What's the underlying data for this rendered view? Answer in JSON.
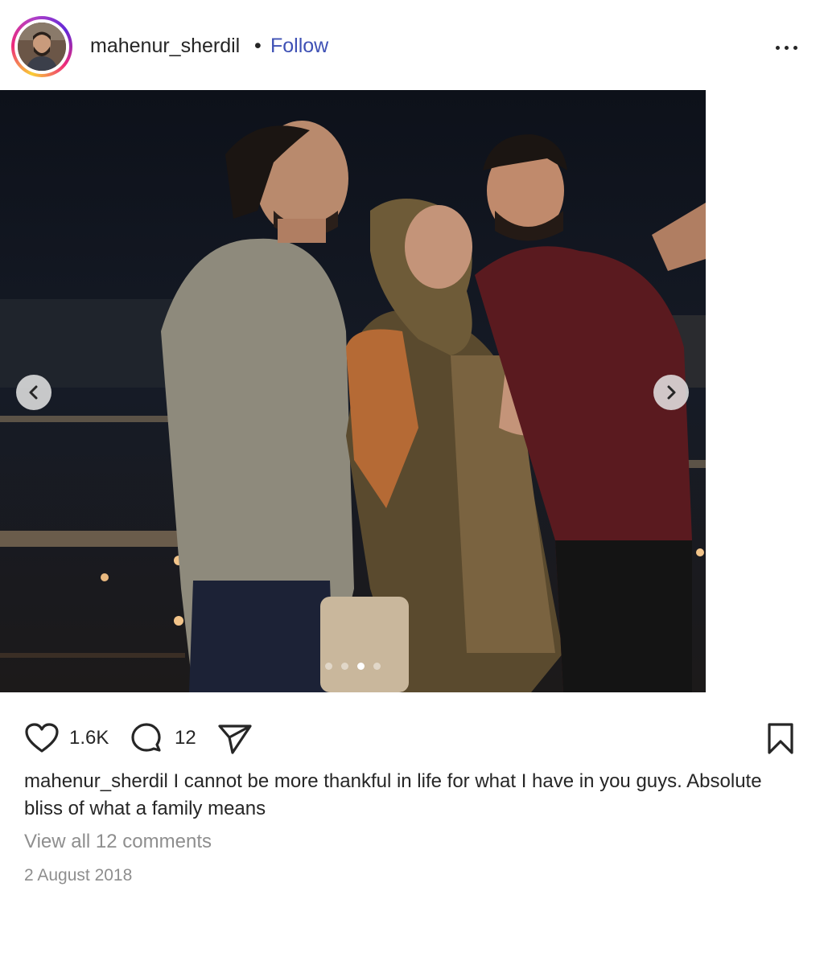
{
  "post": {
    "username": "mahenur_sherdil",
    "separator": "•",
    "follow_label": "Follow",
    "more_icon": "more-horizontal-icon",
    "image_description_icon": "post-photo",
    "carousel": {
      "total_slides": 4,
      "active_slide": 3
    },
    "likes": "1.6K",
    "comments_count": "12",
    "caption_user": "mahenur_sherdil",
    "caption_text": "I cannot be more thankful in life for what I have in you guys. Absolute bliss of what a family means",
    "view_all_comments": "View all 12 comments",
    "date": "2 August 2018"
  },
  "colors": {
    "link": "#3f51b5",
    "text": "#262626",
    "muted": "#8e8e8e"
  }
}
